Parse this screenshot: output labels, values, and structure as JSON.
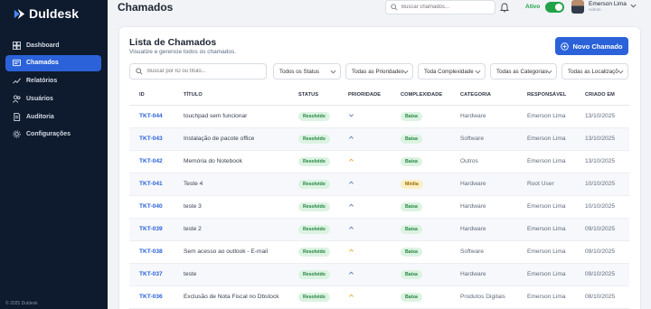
{
  "app": {
    "name": "Duldesk",
    "footer": "© 2025 Duldesk"
  },
  "sidebar": {
    "items": [
      {
        "label": "Dashboard",
        "icon": "dashboard-icon",
        "active": false
      },
      {
        "label": "Chamados",
        "icon": "ticket-icon",
        "active": true
      },
      {
        "label": "Relatórios",
        "icon": "chart-icon",
        "active": false
      },
      {
        "label": "Usuários",
        "icon": "users-icon",
        "active": false
      },
      {
        "label": "Auditoria",
        "icon": "audit-icon",
        "active": false
      },
      {
        "label": "Configurações",
        "icon": "gear-icon",
        "active": false
      }
    ]
  },
  "header": {
    "title": "Chamados",
    "search_placeholder": "Buscar chamados...",
    "status_label": "Ativo",
    "user_name": "Emerson Lima",
    "user_role": "Admin"
  },
  "card": {
    "title": "Lista de Chamados",
    "subtitle": "Visualize e gerencie todos os chamados.",
    "new_button": "Novo Chamado",
    "search_placeholder": "Buscar por ID ou título...",
    "filters": [
      "Todos os Status",
      "Todas as Prioridades",
      "Toda Complexidade",
      "Todas as Categorias",
      "Todas as Localizações"
    ]
  },
  "table": {
    "headers": [
      "ID",
      "Título",
      "Status",
      "Prioridade",
      "Complexidade",
      "Categoria",
      "Responsável",
      "Criado em"
    ],
    "rows": [
      {
        "id": "TKT-044",
        "title": "touchpad sem funcionar",
        "status": "Resolvido",
        "priority": "low",
        "complexity": "Baixa",
        "category": "Hardware",
        "owner": "Emerson Lima",
        "created": "13/10/2025"
      },
      {
        "id": "TKT-043",
        "title": "Instalação de pacote office",
        "status": "Resolvido",
        "priority": "high",
        "complexity": "Baixa",
        "category": "Software",
        "owner": "Emerson Lima",
        "created": "13/10/2025"
      },
      {
        "id": "TKT-042",
        "title": "Memória do Notebook",
        "status": "Resolvido",
        "priority": "medium",
        "complexity": "Baixa",
        "category": "Outros",
        "owner": "Emerson Lima",
        "created": "13/10/2025"
      },
      {
        "id": "TKT-041",
        "title": "Teste 4",
        "status": "Resolvido",
        "priority": "high",
        "complexity": "Média",
        "category": "Hardware",
        "owner": "Root User",
        "created": "10/10/2025"
      },
      {
        "id": "TKT-040",
        "title": "teste 3",
        "status": "Resolvido",
        "priority": "high",
        "complexity": "Baixa",
        "category": "Hardware",
        "owner": "Emerson Lima",
        "created": "10/10/2025"
      },
      {
        "id": "TKT-039",
        "title": "teste 2",
        "status": "Resolvido",
        "priority": "high",
        "complexity": "Baixa",
        "category": "Hardware",
        "owner": "Emerson Lima",
        "created": "09/10/2025"
      },
      {
        "id": "TKT-038",
        "title": "Sem acesso ao outlook - E-mail",
        "status": "Resolvido",
        "priority": "medium",
        "complexity": "Baixa",
        "category": "Software",
        "owner": "Emerson Lima",
        "created": "09/10/2025"
      },
      {
        "id": "TKT-037",
        "title": "teste",
        "status": "Resolvido",
        "priority": "high",
        "complexity": "Baixa",
        "category": "Hardware",
        "owner": "Emerson Lima",
        "created": "09/10/2025"
      },
      {
        "id": "TKT-036",
        "title": "Exclusão de Nota Fiscal no Dbstock",
        "status": "Resolvido",
        "priority": "medium",
        "complexity": "Baixa",
        "category": "Produtos Digitais",
        "owner": "Emerson Lima",
        "created": "08/10/2025"
      }
    ]
  },
  "colors": {
    "primary": "#2b62d9",
    "sidebar": "#0e1a2e",
    "success": "#22a34a",
    "warning": "#e8a21a"
  }
}
